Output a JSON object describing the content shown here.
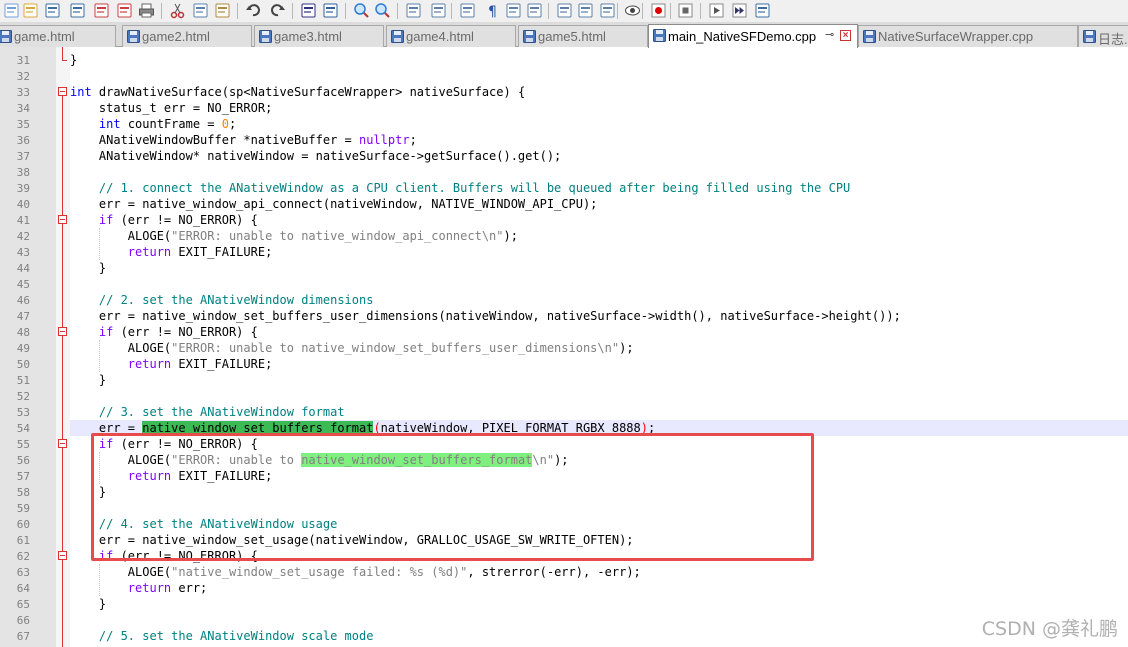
{
  "toolbar": {
    "icons": [
      "new-file-icon",
      "open-file-icon",
      "save-icon",
      "save-all-icon",
      "close-icon",
      "close-all-icon",
      "print-icon",
      "cut-icon",
      "copy-icon",
      "paste-icon",
      "undo-icon",
      "redo-icon",
      "find-icon",
      "replace-icon",
      "zoom-in-icon",
      "zoom-out-icon",
      "sync-vertical-icon",
      "sync-horizontal-icon",
      "word-wrap-icon",
      "show-all-chars-icon",
      "indent-guide-icon",
      "udl-icon",
      "function-list-icon",
      "folder-workspace-icon",
      "document-map-icon",
      "monitoring-icon",
      "record-macro-icon",
      "stop-record-icon",
      "play-macro-icon",
      "run-macro-multiple-icon",
      "save-macro-icon"
    ]
  },
  "tabs": [
    {
      "label": "game.html",
      "active": false
    },
    {
      "label": "game2.html",
      "active": false
    },
    {
      "label": "game3.html",
      "active": false
    },
    {
      "label": "game4.html",
      "active": false
    },
    {
      "label": "game5.html",
      "active": false
    },
    {
      "label": "main_NativeSFDemo.cpp",
      "active": true
    },
    {
      "label": "NativeSurfaceWrapper.cpp",
      "active": false
    },
    {
      "label": "日志.",
      "active": false
    }
  ],
  "editor": {
    "current_line": 54,
    "lines": [
      {
        "n": "31",
        "html": "}"
      },
      {
        "n": "32",
        "html": ""
      },
      {
        "n": "33",
        "html": "<span class='typekw'>int</span> drawNativeSurface(sp&lt;NativeSurfaceWrapper&gt; nativeSurface) {"
      },
      {
        "n": "34",
        "html": "    status_t err = NO_ERROR;"
      },
      {
        "n": "35",
        "html": "    <span class='typekw'>int</span> countFrame = <span class='num'>0</span>;"
      },
      {
        "n": "36",
        "html": "    ANativeWindowBuffer *nativeBuffer = <span class='kw'>nullptr</span>;"
      },
      {
        "n": "37",
        "html": "    ANativeWindow* nativeWindow = nativeSurface-&gt;getSurface().get();"
      },
      {
        "n": "38",
        "html": ""
      },
      {
        "n": "39",
        "html": "    <span class='com'>// 1. connect the ANativeWindow as a CPU client. Buffers will be queued after being filled using the CPU</span>"
      },
      {
        "n": "40",
        "html": "    err = native_window_api_connect(nativeWindow, NATIVE_WINDOW_API_CPU);"
      },
      {
        "n": "41",
        "html": "    <span class='kw'>if</span> (err != NO_ERROR) {"
      },
      {
        "n": "42",
        "html": "        ALOGE(<span class='str'>\"ERROR: unable to native_window_api_connect\\n\"</span>);"
      },
      {
        "n": "43",
        "html": "        <span class='kw'>return</span> EXIT_FAILURE;"
      },
      {
        "n": "44",
        "html": "    }"
      },
      {
        "n": "45",
        "html": ""
      },
      {
        "n": "46",
        "html": "    <span class='com'>// 2. set the ANativeWindow dimensions</span>"
      },
      {
        "n": "47",
        "html": "    err = native_window_set_buffers_user_dimensions(nativeWindow, nativeSurface-&gt;width(), nativeSurface-&gt;height());"
      },
      {
        "n": "48",
        "html": "    <span class='kw'>if</span> (err != NO_ERROR) {"
      },
      {
        "n": "49",
        "html": "        ALOGE(<span class='str'>\"ERROR: unable to native_window_set_buffers_user_dimensions\\n\"</span>);"
      },
      {
        "n": "50",
        "html": "        <span class='kw'>return</span> EXIT_FAILURE;"
      },
      {
        "n": "51",
        "html": "    }"
      },
      {
        "n": "52",
        "html": ""
      },
      {
        "n": "53",
        "html": "    <span class='com'>// 3. set the ANativeWindow format</span>"
      },
      {
        "n": "54",
        "html": "    err = <span class='hl1'>native_window_set_buffers_format</span><span class='brace'>(</span>nativeWindow, PIXEL_FORMAT_RGBX_8888<span class='brace'>)</span>;"
      },
      {
        "n": "55",
        "html": "    <span class='kw'>if</span> (err != NO_ERROR) {"
      },
      {
        "n": "56",
        "html": "        ALOGE(<span class='str'>\"ERROR: unable to </span><span class='hl2'>native_window_set_buffers_format</span><span class='str'>\\n\"</span>);"
      },
      {
        "n": "57",
        "html": "        <span class='kw'>return</span> EXIT_FAILURE;"
      },
      {
        "n": "58",
        "html": "    }"
      },
      {
        "n": "59",
        "html": ""
      },
      {
        "n": "60",
        "html": "    <span class='com'>// 4. set the ANativeWindow usage</span>"
      },
      {
        "n": "61",
        "html": "    err = native_window_set_usage(nativeWindow, GRALLOC_USAGE_SW_WRITE_OFTEN);"
      },
      {
        "n": "62",
        "html": "    <span class='kw'>if</span> (err != NO_ERROR) {"
      },
      {
        "n": "63",
        "html": "        ALOGE(<span class='str'>\"native_window_set_usage failed: %s (%d)\"</span>, strerror(-err), -err);"
      },
      {
        "n": "64",
        "html": "        <span class='kw'>return</span> err;"
      },
      {
        "n": "65",
        "html": "    }"
      },
      {
        "n": "66",
        "html": ""
      },
      {
        "n": "67",
        "html": "    <span class='com'>// 5. set the ANativeWindow scale mode</span>"
      }
    ]
  },
  "watermark": "CSDN @龚礼鹏",
  "colors": {
    "keyword": "#0000ff",
    "comment": "#008080",
    "string": "#808080",
    "highlight": "#3cba54",
    "annotation_box": "#e84b4b"
  }
}
